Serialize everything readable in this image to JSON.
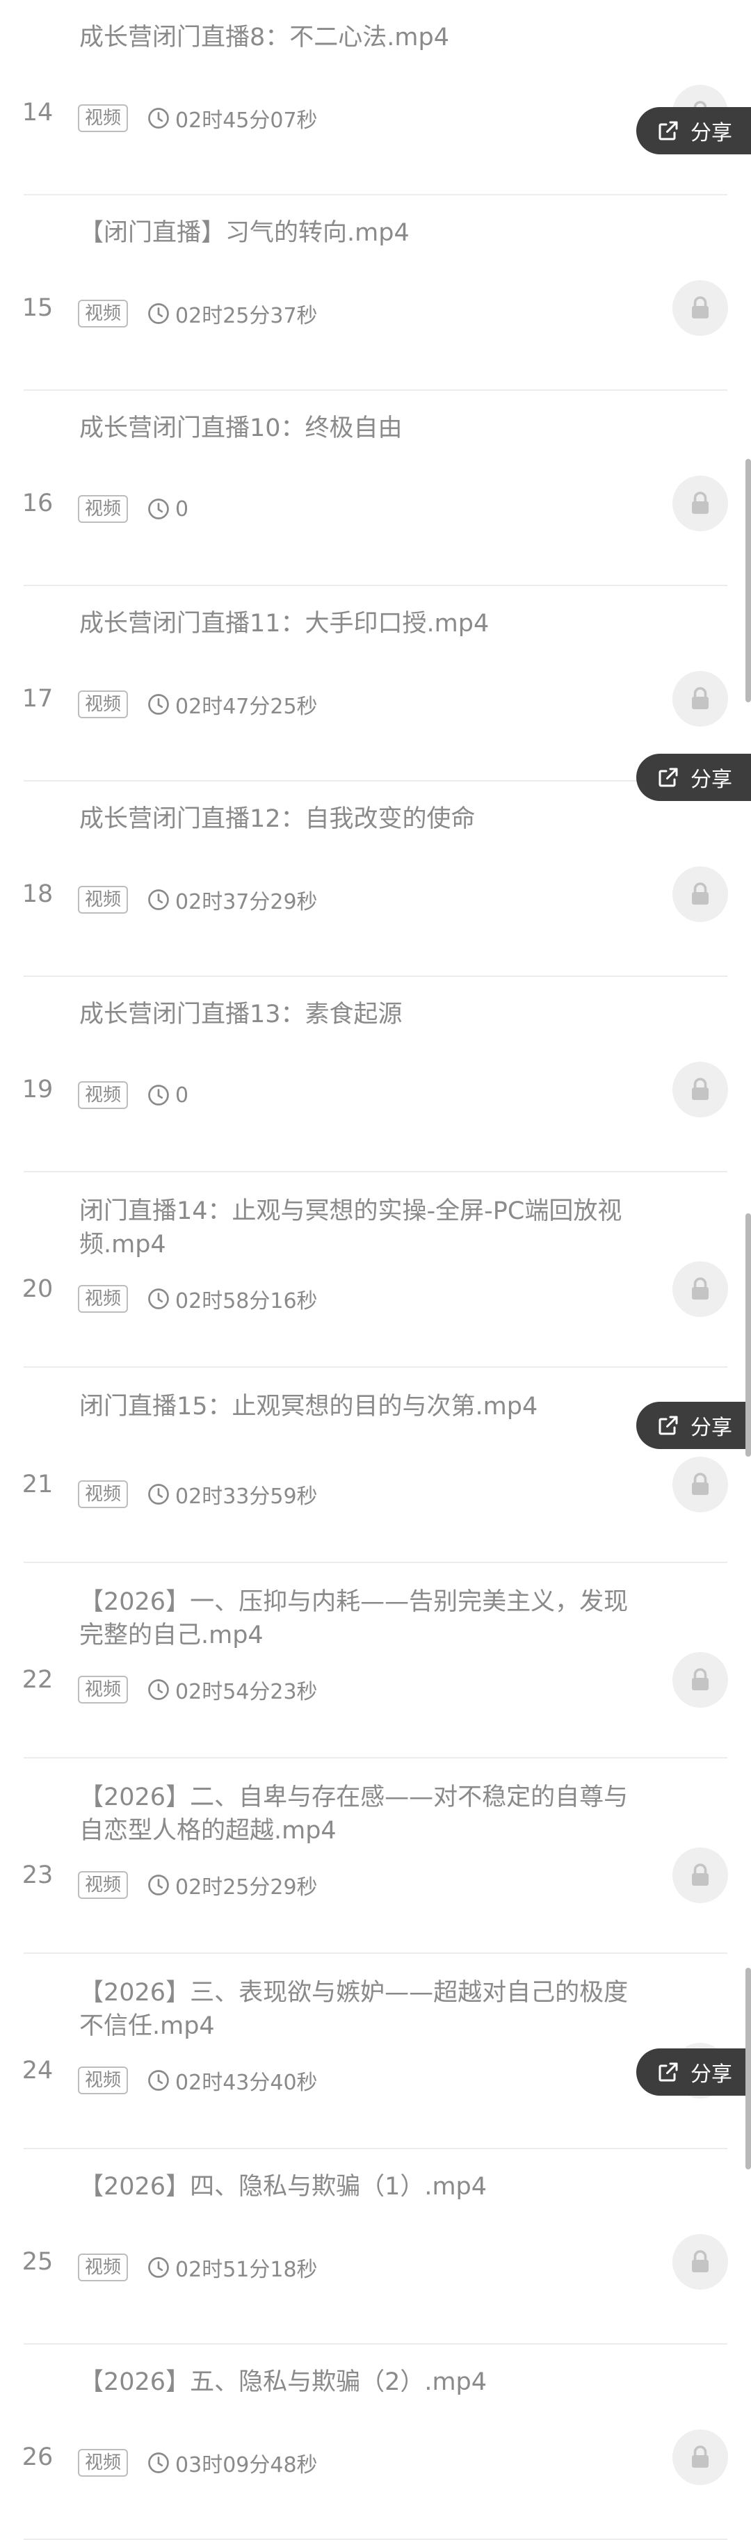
{
  "labels": {
    "video_tag": "视频",
    "share": "分享"
  },
  "icons": {
    "lock": "lock-icon",
    "clock": "clock-icon",
    "share": "share-icon"
  },
  "colors": {
    "text": "#8a8a8a",
    "share_bg": "#3d3d3d",
    "lock_bg": "#efefef",
    "divider": "#ececec"
  },
  "items": [
    {
      "num": "14",
      "title": "成长营闭门直播8：不二心法.mp4",
      "duration": "02时45分07秒"
    },
    {
      "num": "15",
      "title": "【闭门直播】习气的转向.mp4",
      "duration": "02时25分37秒"
    },
    {
      "num": "16",
      "title": "成长营闭门直播10：终极自由",
      "duration": "0"
    },
    {
      "num": "17",
      "title": "成长营闭门直播11：大手印口授.mp4",
      "duration": "02时47分25秒"
    },
    {
      "num": "18",
      "title": "成长营闭门直播12：自我改变的使命",
      "duration": "02时37分29秒"
    },
    {
      "num": "19",
      "title": "成长营闭门直播13：素食起源",
      "duration": "0"
    },
    {
      "num": "20",
      "title": "闭门直播14：止观与冥想的实操-全屏-PC端回放视频.mp4",
      "duration": "02时58分16秒"
    },
    {
      "num": "21",
      "title": "闭门直播15：止观冥想的目的与次第.mp4",
      "duration": "02时33分59秒"
    },
    {
      "num": "22",
      "title": "【2026】一、压抑与内耗——告别完美主义，发现完整的自己.mp4",
      "duration": "02时54分23秒"
    },
    {
      "num": "23",
      "title": "【2026】二、自卑与存在感——对不稳定的自尊与自恋型人格的超越.mp4",
      "duration": "02时25分29秒"
    },
    {
      "num": "24",
      "title": "【2026】三、表现欲与嫉妒——超越对自己的极度不信任.mp4",
      "duration": "02时43分40秒"
    },
    {
      "num": "25",
      "title": "【2026】四、隐私与欺骗（1）.mp4",
      "duration": "02时51分18秒"
    },
    {
      "num": "26",
      "title": "【2026】五、隐私与欺骗（2）.mp4",
      "duration": "03时09分48秒"
    }
  ]
}
